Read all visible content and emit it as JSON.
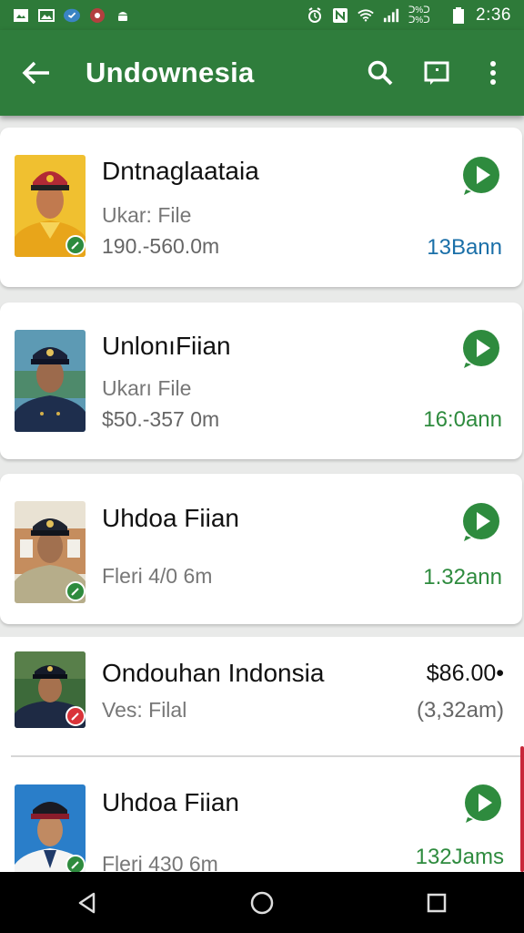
{
  "status_bar": {
    "time": "2:36",
    "left_icons": [
      "image-icon",
      "gallery-icon",
      "shield-icon",
      "record-icon",
      "android-icon"
    ],
    "right_icons": [
      "alarm-icon",
      "nfc-icon",
      "wifi-icon",
      "signal-icon",
      "battery-icon"
    ],
    "carrier_text": "ᑐ%\nᑐ%"
  },
  "app_bar": {
    "title": "Undownesia",
    "back_icon": "arrow-left-icon",
    "actions": [
      "search-icon",
      "message-icon",
      "more-vert-icon"
    ]
  },
  "colors": {
    "primary": "#2f7d3c",
    "status": "#2e7a39",
    "accent_green": "#2e8b3e",
    "accent_blue": "#1a6fa8",
    "badge_red": "#d9343a"
  },
  "items": [
    {
      "name": "Dntnaglaataia",
      "sub": "Ukar: File",
      "sub2": "190.-560.0m",
      "time": "13Bann",
      "action": "play-icon"
    },
    {
      "name": "UnlonıFiian",
      "sub": "Ukarı File",
      "sub2": "$50.-357 0m",
      "time": "16:0ann",
      "action": "play-icon"
    },
    {
      "name": "Uhdoa Fiian",
      "sub": "Fleri 4/0 6m",
      "time": "1.32ann",
      "action": "play-icon"
    },
    {
      "name": "Ondouhan Indonsia",
      "sub": "Ves: Filal",
      "price": "$86.00•",
      "time": "(3,32am)"
    },
    {
      "name": "Uhdoa Fiian",
      "sub": "Fleri 430 6m",
      "time": "132Jams",
      "action": "play-icon"
    }
  ],
  "nav_bar": {
    "buttons": [
      "back-triangle-icon",
      "home-circle-icon",
      "recents-square-icon"
    ]
  }
}
